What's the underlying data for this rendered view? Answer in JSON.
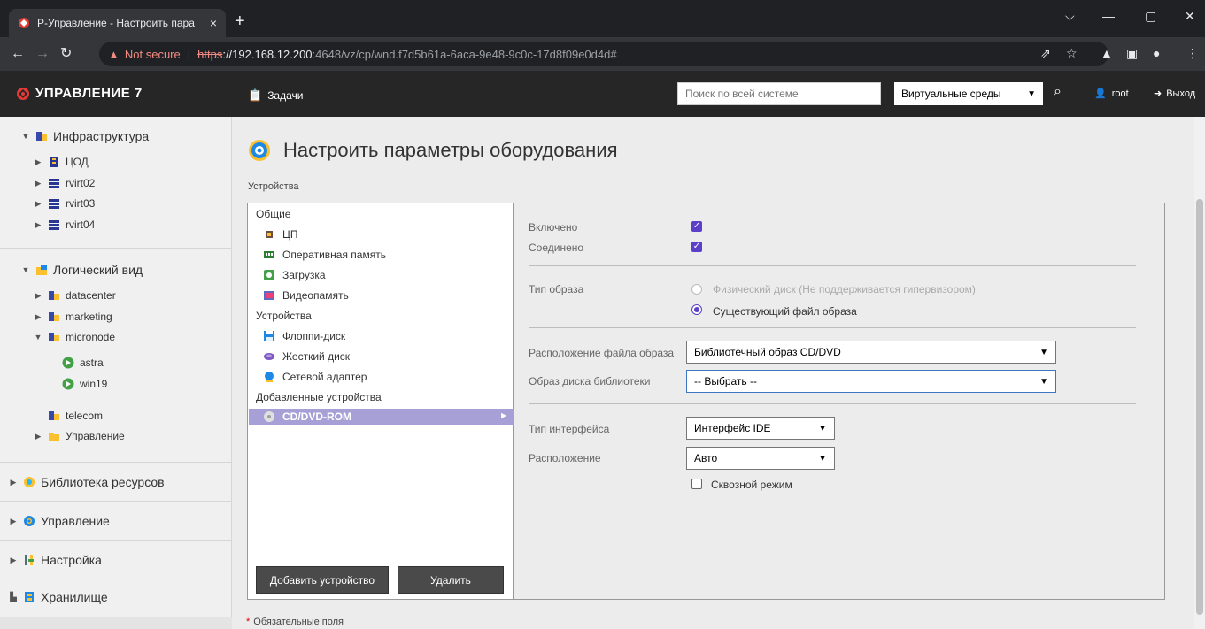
{
  "browser": {
    "tab_title": "Р-Управление - Настроить пара",
    "tab_close": "×",
    "new_tab": "+",
    "window_controls": [
      "⌵",
      "—",
      "▢",
      "✕"
    ],
    "not_secure": "Not secure",
    "url_scheme": "https",
    "url_host": "://192.168.12.200",
    "url_path": ":4648/vz/cp/wnd.f7d5b61a-6aca-9e48-9c0c-17d8f09e0d4d#"
  },
  "header": {
    "brand": "УПРАВЛЕНИЕ 7",
    "tasks_label": "Задачи",
    "search_placeholder": "Поиск по всей системе",
    "env_select": "Виртуальные среды",
    "user": "root",
    "logout": "Выход"
  },
  "sidebar": {
    "infra": "Инфраструктура",
    "infra_items": [
      "ЦОД",
      "rvirt02",
      "rvirt03",
      "rvirt04"
    ],
    "logical": "Логический вид",
    "logical_items": [
      "datacenter",
      "marketing",
      "micronode"
    ],
    "vms": [
      "astra",
      "win19"
    ],
    "telecom": "telecom",
    "management_folder": "Управление",
    "sections": [
      "Библиотека ресурсов",
      "Управление",
      "Настройка",
      "Хранилище"
    ]
  },
  "page": {
    "title": "Настроить параметры оборудования",
    "group_label": "Устройства",
    "required_note": "Обязательные поля"
  },
  "devices": {
    "general_header": "Общие",
    "general": [
      "ЦП",
      "Оперативная память",
      "Загрузка",
      "Видеопамять"
    ],
    "devices_header": "Устройства",
    "devices": [
      "Флоппи-диск",
      "Жесткий диск",
      "Сетевой адаптер"
    ],
    "added_header": "Добавленные устройства",
    "added": [
      "CD/DVD-ROM"
    ],
    "add_button": "Добавить устройство",
    "delete_button": "Удалить"
  },
  "props": {
    "enabled_label": "Включено",
    "connected_label": "Соединено",
    "image_type_label": "Тип образа",
    "physical_disk": "Физический диск  (Не поддерживается гипервизором)",
    "existing_file": "Существующий файл образа",
    "image_location_label": "Расположение файла образа",
    "image_location_value": "Библиотечный образ CD/DVD",
    "library_image_label": "Образ диска библиотеки",
    "library_image_value": "-- Выбрать --",
    "interface_type_label": "Тип интерфейса",
    "interface_type_value": "Интерфейс IDE",
    "location_label": "Расположение",
    "location_value": "Авто",
    "passthrough_label": "Сквозной режим"
  },
  "colors": {
    "accent": "#5b3fc9",
    "header_bg": "#262626",
    "selected_row": "#a7a0d6"
  }
}
